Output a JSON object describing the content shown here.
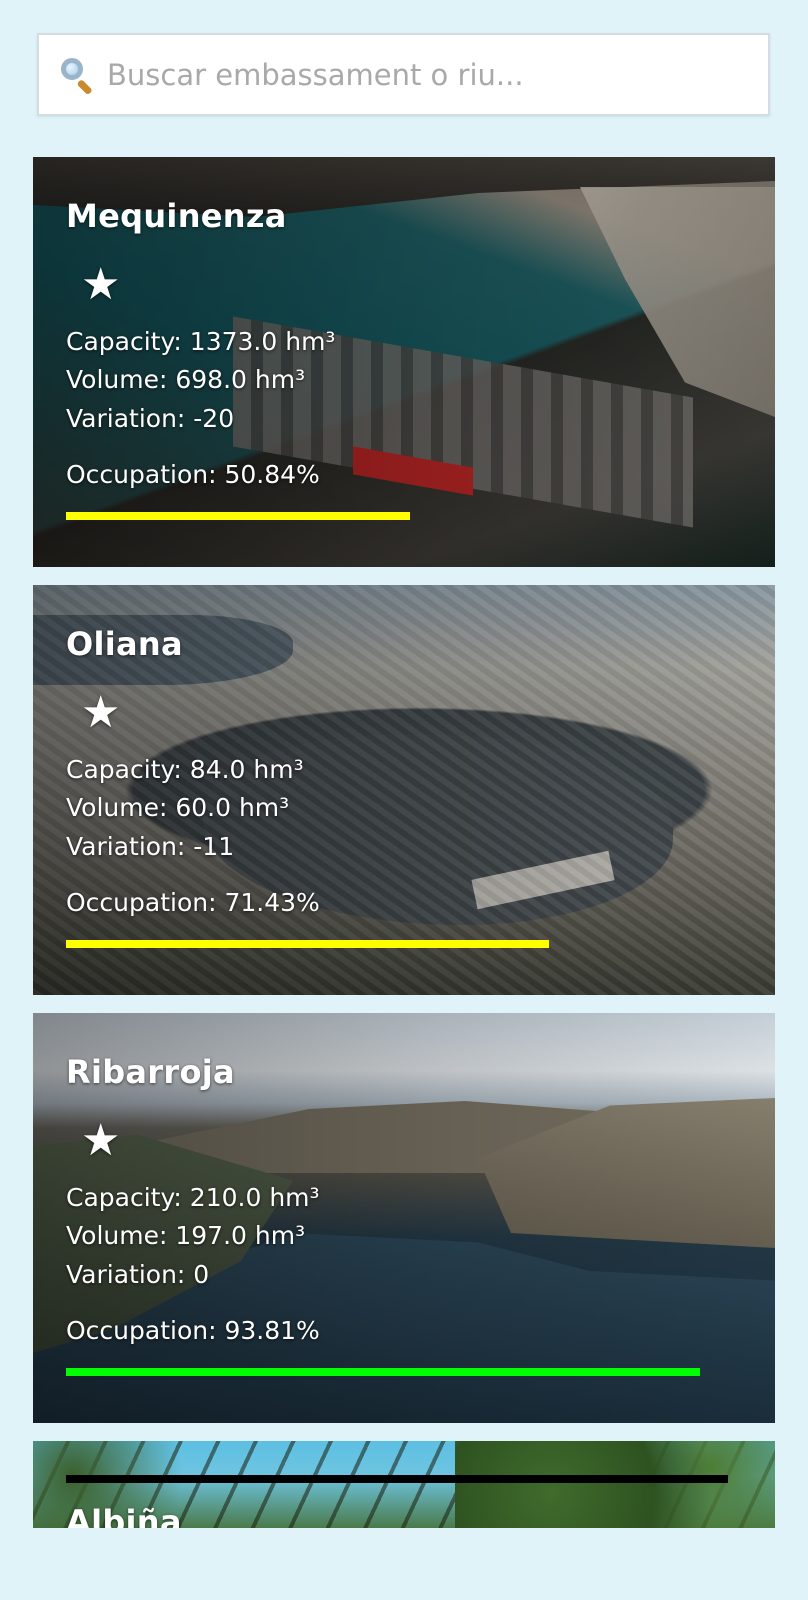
{
  "search": {
    "placeholder": "Buscar embassament o riu...",
    "value": ""
  },
  "reservoirs": [
    {
      "name": "Mequinenza",
      "favorite_icon": "★",
      "capacity": "Capacity: 1373.0 hm³",
      "volume": "Volume: 698.0 hm³",
      "variation": "Variation: -20",
      "occupation": "Occupation: 50.84%",
      "occupation_fraction": 0.5084,
      "bar_color": "#ffff00"
    },
    {
      "name": "Oliana",
      "favorite_icon": "★",
      "capacity": "Capacity: 84.0 hm³",
      "volume": "Volume: 60.0 hm³",
      "variation": "Variation: -11",
      "occupation": "Occupation: 71.43%",
      "occupation_fraction": 0.7143,
      "bar_color": "#ffff00"
    },
    {
      "name": "Ribarroja",
      "favorite_icon": "★",
      "capacity": "Capacity: 210.0 hm³",
      "volume": "Volume: 197.0 hm³",
      "variation": "Variation: 0",
      "occupation": "Occupation: 93.81%",
      "occupation_fraction": 0.9381,
      "bar_color": "#00ff00"
    },
    {
      "name": "Albiña"
    }
  ],
  "colors": {
    "background": "#dff3f8",
    "card_text": "#ffffff"
  }
}
